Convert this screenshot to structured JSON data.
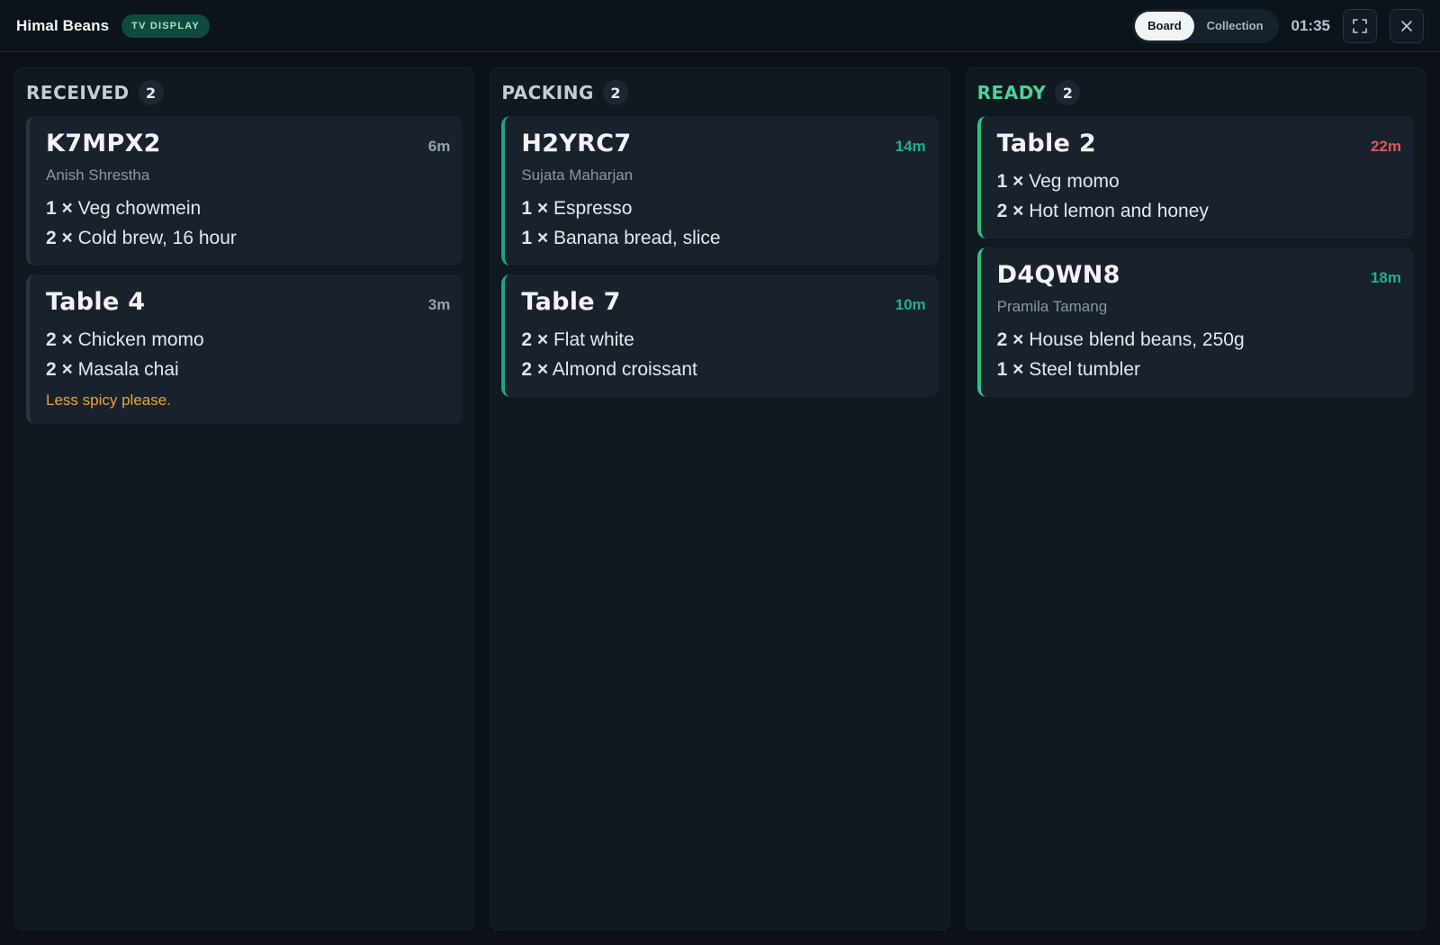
{
  "header": {
    "brand": "Himal Beans",
    "mode_badge": "TV DISPLAY",
    "views": [
      "Board",
      "Collection"
    ],
    "active_view": "Board",
    "clock": "01:35",
    "expand_icon": "expand-icon",
    "close_icon": "close-icon"
  },
  "colors": {
    "ready": "#4fd09b",
    "teal_accent": "#1fa385",
    "late": "#e0565a",
    "note": "#e4a540"
  },
  "columns": [
    {
      "title": "RECEIVED",
      "count": "2",
      "cards": [
        {
          "title": "K7MPX2",
          "elapsed": "6m",
          "customer": "Anish Shrestha",
          "items": [
            {
              "qty": "1 ×",
              "name": "Veg chowmein"
            },
            {
              "qty": "2 ×",
              "name": "Cold brew, 16 hour"
            }
          ]
        },
        {
          "title": "Table 4",
          "elapsed": "3m",
          "items": [
            {
              "qty": "2 ×",
              "name": "Chicken momo"
            },
            {
              "qty": "2 ×",
              "name": "Masala chai"
            }
          ],
          "note": "Less spicy please."
        }
      ]
    },
    {
      "title": "PACKING",
      "count": "2",
      "cards": [
        {
          "title": "H2YRC7",
          "elapsed": "14m",
          "customer": "Sujata Maharjan",
          "items": [
            {
              "qty": "1 ×",
              "name": "Espresso"
            },
            {
              "qty": "1 ×",
              "name": "Banana bread, slice"
            }
          ]
        },
        {
          "title": "Table 7",
          "elapsed": "10m",
          "items": [
            {
              "qty": "2 ×",
              "name": "Flat white"
            },
            {
              "qty": "2 ×",
              "name": "Almond croissant"
            }
          ]
        }
      ]
    },
    {
      "title": "READY",
      "count": "2",
      "cards": [
        {
          "title": "Table 2",
          "elapsed": "22m",
          "items": [
            {
              "qty": "1 ×",
              "name": "Veg momo"
            },
            {
              "qty": "2 ×",
              "name": "Hot lemon and honey"
            }
          ]
        },
        {
          "title": "D4QWN8",
          "elapsed": "18m",
          "customer": "Pramila Tamang",
          "items": [
            {
              "qty": "2 ×",
              "name": "House blend beans, 250g"
            },
            {
              "qty": "1 ×",
              "name": "Steel tumbler"
            }
          ]
        }
      ]
    }
  ]
}
